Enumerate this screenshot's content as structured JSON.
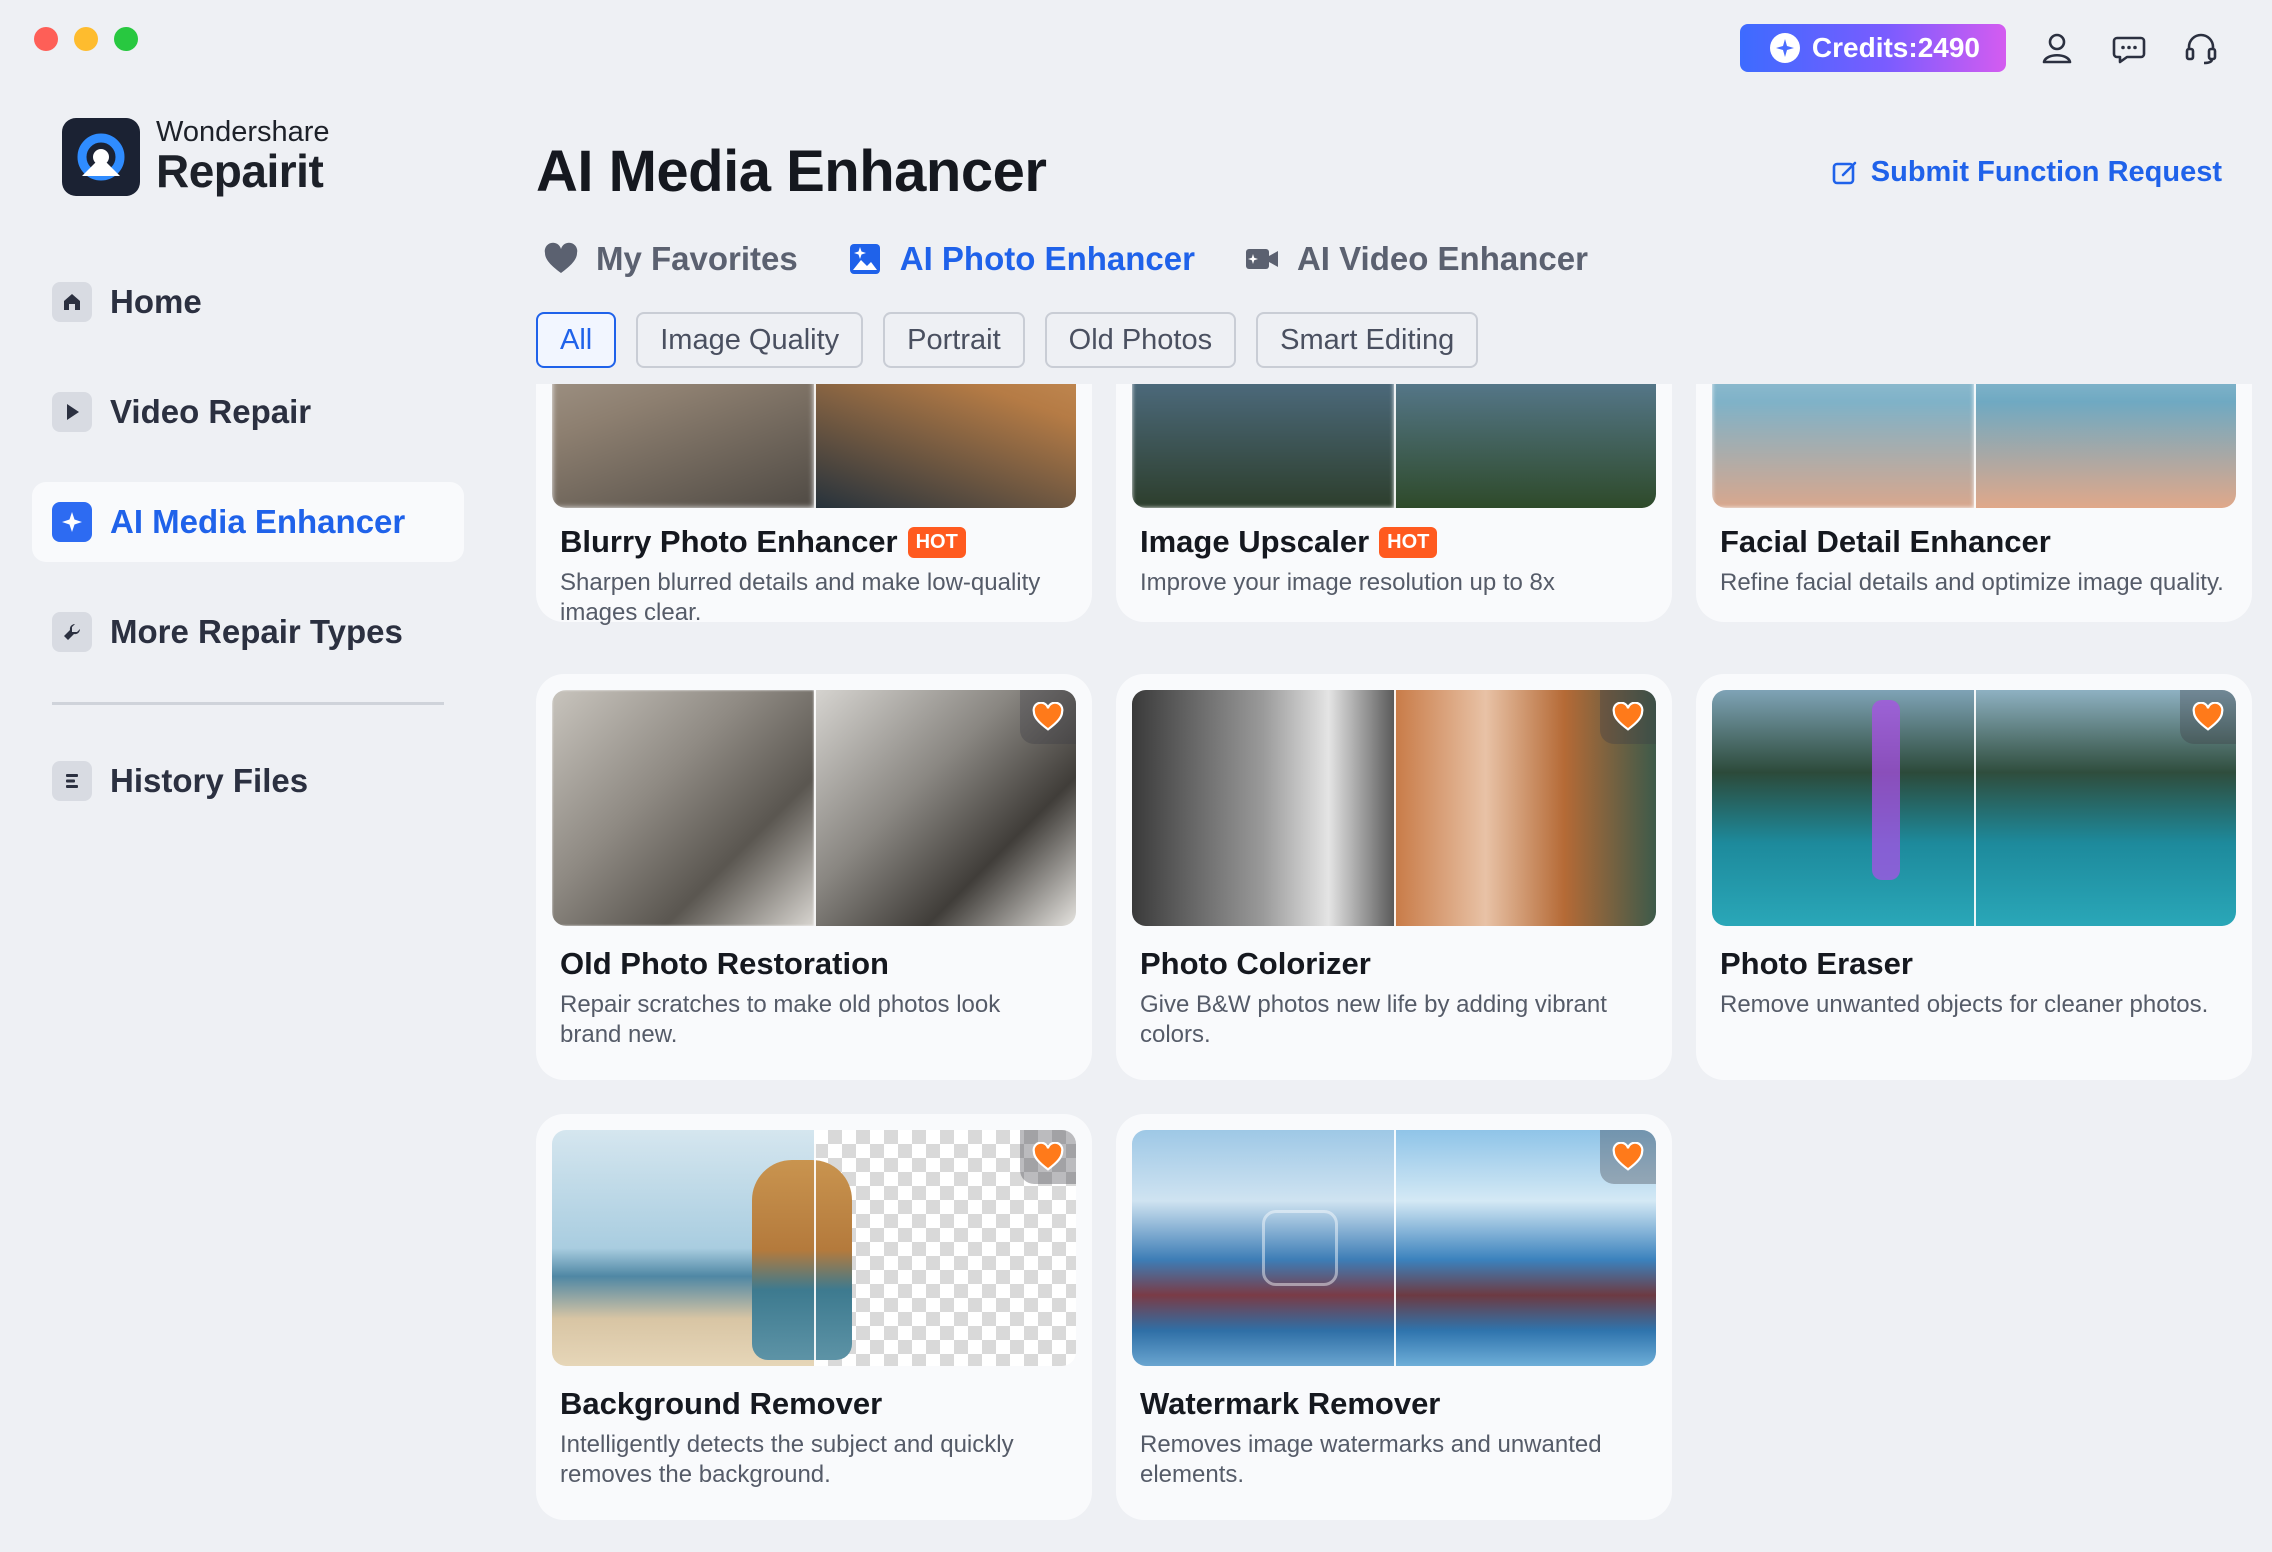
{
  "credits": {
    "label": "Credits:2490"
  },
  "brand": {
    "company": "Wondershare",
    "product": "Repairit"
  },
  "sidebar": {
    "items": [
      {
        "label": "Home",
        "icon": "home-icon"
      },
      {
        "label": "Video Repair",
        "icon": "play-icon"
      },
      {
        "label": "AI Media Enhancer",
        "icon": "sparkle-icon",
        "active": true
      },
      {
        "label": "More Repair Types",
        "icon": "wrench-icon"
      }
    ],
    "history": {
      "label": "History Files",
      "icon": "list-icon"
    }
  },
  "header": {
    "title": "AI Media Enhancer",
    "submit_request": "Submit Function Request"
  },
  "tabs": [
    {
      "label": "My Favorites",
      "icon": "heart-icon"
    },
    {
      "label": "AI Photo Enhancer",
      "icon": "photo-enhance-icon",
      "active": true
    },
    {
      "label": "AI Video Enhancer",
      "icon": "video-camera-icon"
    }
  ],
  "filters": [
    "All",
    "Image Quality",
    "Portrait",
    "Old Photos",
    "Smart Editing"
  ],
  "cards": [
    {
      "title": "Blurry Photo Enhancer",
      "badge": "HOT",
      "desc": "Sharpen blurred details and make low-quality images clear."
    },
    {
      "title": "Image Upscaler",
      "badge": "HOT",
      "desc": "Improve your image resolution up to 8x"
    },
    {
      "title": "Facial Detail Enhancer",
      "badge": "",
      "desc": "Refine facial details and optimize image quality."
    },
    {
      "title": "Old Photo Restoration",
      "badge": "",
      "desc": "Repair scratches to make old photos look brand new."
    },
    {
      "title": "Photo Colorizer",
      "badge": "",
      "desc": "Give B&W photos new life by adding vibrant colors."
    },
    {
      "title": "Photo Eraser",
      "badge": "",
      "desc": "Remove unwanted objects for cleaner photos."
    },
    {
      "title": "Background Remover",
      "badge": "",
      "desc": "Intelligently detects the subject and quickly removes the background."
    },
    {
      "title": "Watermark Remover",
      "badge": "",
      "desc": "Removes image watermarks and unwanted elements."
    }
  ],
  "colors": {
    "accent": "#1f62ea",
    "hot": "#ff5a1f",
    "favorite": "#ff7a1a"
  }
}
